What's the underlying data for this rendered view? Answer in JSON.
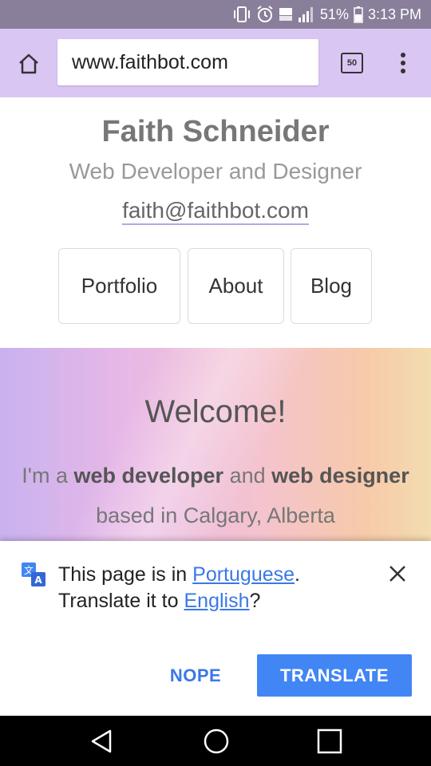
{
  "status_bar": {
    "battery_percent": "51%",
    "time": "3:13 PM",
    "icons": [
      "vibrate-icon",
      "alarm-icon",
      "lte-icon",
      "signal-icon",
      "battery-icon"
    ]
  },
  "browser": {
    "url": "www.faithbot.com",
    "tab_count": "50",
    "toolbar_color": "#d9c6f3"
  },
  "site": {
    "name": "Faith Schneider",
    "tagline": "Web Developer and Designer",
    "email": "faith@faithbot.com",
    "nav": [
      "Portfolio",
      "About",
      "Blog"
    ],
    "hero": {
      "heading": "Welcome!",
      "intro_prefix": "I'm a",
      "intro_bold1": "web developer",
      "intro_and": "and",
      "intro_bold2": "web designer",
      "intro_line2": "based in Calgary, Alberta"
    }
  },
  "translate": {
    "msg_part1": "This page is in",
    "source_lang": "Portuguese",
    "msg_part2": ".",
    "msg_part3": "Translate it to",
    "target_lang": "English",
    "msg_part4": "?",
    "nope_label": "NOPE",
    "translate_label": "TRANSLATE",
    "accent_color": "#4285f4"
  }
}
